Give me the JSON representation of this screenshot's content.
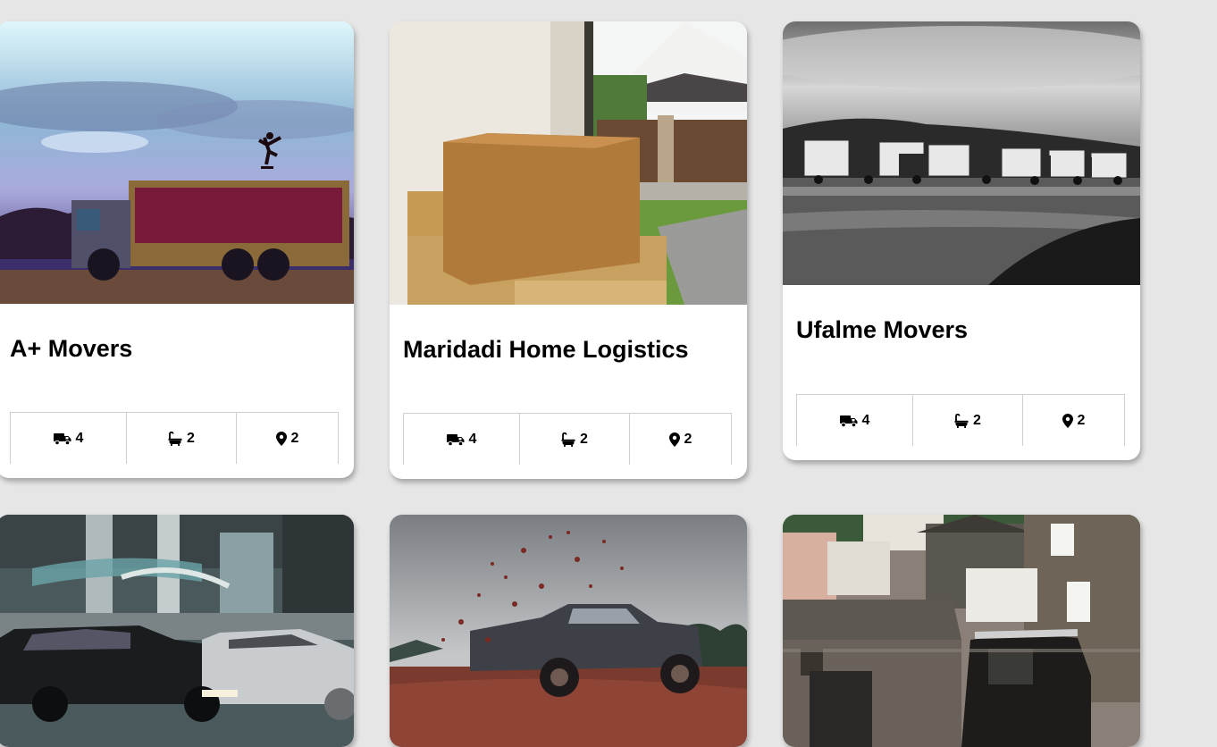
{
  "listings": [
    {
      "name": "A+ Movers",
      "image": "truck-skateboarder-photo",
      "stats": {
        "trucks": "4",
        "baths": "2",
        "locations": "2"
      }
    },
    {
      "name": "Maridadi Home Logistics",
      "image": "cardboard-boxes-photo",
      "stats": {
        "trucks": "4",
        "baths": "2",
        "locations": "2"
      }
    },
    {
      "name": "Ufalme Movers",
      "image": "truck-fleet-bw-photo",
      "stats": {
        "trucks": "4",
        "baths": "2",
        "locations": "2"
      }
    },
    {
      "image": "cars-motion-blur-photo"
    },
    {
      "image": "pickup-truck-mud-photo"
    },
    {
      "image": "stone-village-photo"
    }
  ],
  "icons": {
    "trucks": "truck-icon",
    "baths": "bath-icon",
    "locations": "map-pin-icon"
  }
}
